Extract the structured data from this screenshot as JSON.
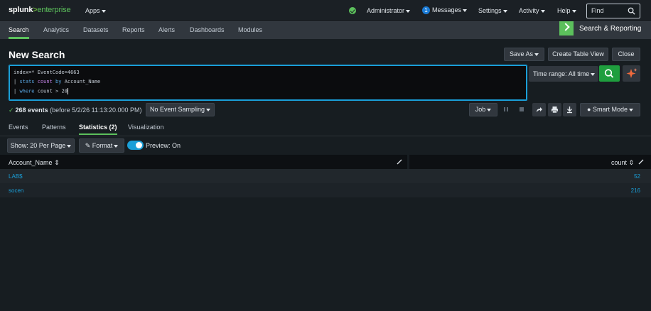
{
  "topbar": {
    "brand_main": "splunk",
    "brand_gt": ">",
    "brand_sub": "enterprise",
    "apps": "Apps",
    "user": "Administrator",
    "messages_count": "1",
    "messages": "Messages",
    "settings": "Settings",
    "activity": "Activity",
    "help": "Help",
    "find_placeholder": "Find"
  },
  "nav": {
    "tabs": [
      "Search",
      "Analytics",
      "Datasets",
      "Reports",
      "Alerts",
      "Dashboards",
      "Modules"
    ],
    "app_title": "Search & Reporting"
  },
  "page": {
    "title": "New Search",
    "save_as": "Save As",
    "create_table_view": "Create Table View",
    "close": "Close"
  },
  "search": {
    "line1": "index=* EventCode=4663",
    "line2_pipe": "| ",
    "line2_cmd": "stats",
    "line2_fn": "count",
    "line2_by": "by",
    "line2_rest": "Account_Name",
    "line3_pipe": "| ",
    "line3_cmd": "where",
    "line3_rest": "count > 20",
    "time_range": "Time range: All time"
  },
  "status": {
    "check": "✓",
    "events": "268 events",
    "detail": "(before 5/2/26 11:13:20.000 PM)",
    "sampling": "No Event Sampling",
    "job": "Job",
    "smart_mode": "Smart Mode"
  },
  "result_tabs": [
    "Events",
    "Patterns",
    "Statistics (2)",
    "Visualization"
  ],
  "table_controls": {
    "per_page": "Show: 20 Per Page",
    "format": "Format",
    "preview": "Preview: On"
  },
  "table": {
    "columns": [
      "Account_Name",
      "count"
    ],
    "rows": [
      {
        "account": "LAB$",
        "count": "52"
      },
      {
        "account": "socen",
        "count": "216"
      }
    ]
  },
  "colors": {
    "accent_green": "#5cc05c",
    "link_blue": "#1a9fd8",
    "background": "#171d21"
  }
}
